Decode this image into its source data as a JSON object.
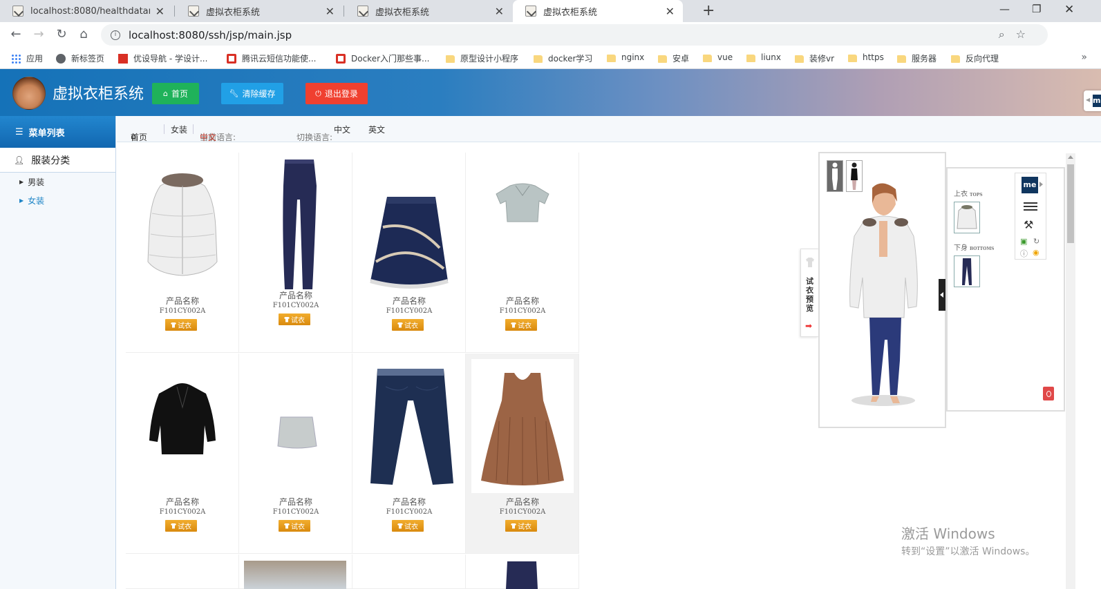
{
  "browser": {
    "tabs": [
      {
        "title": "localhost:8080/healthdataman",
        "active": false
      },
      {
        "title": "虚拟衣柜系统",
        "active": false
      },
      {
        "title": "虚拟衣柜系统",
        "active": false
      },
      {
        "title": "虚拟衣柜系统",
        "active": true
      }
    ],
    "url": "localhost:8080/ssh/jsp/main.jsp",
    "bookmarks": [
      {
        "label": "应用",
        "icon": "apps-grid-icon"
      },
      {
        "label": "新标签页",
        "icon": "globe-icon"
      },
      {
        "label": "优设导航 - 学设计...",
        "icon": "uisdc-icon"
      },
      {
        "label": "腾讯云短信功能使...",
        "icon": "csdn-icon"
      },
      {
        "label": "Docker入门那些事...",
        "icon": "csdn-icon"
      },
      {
        "label": "原型设计小程序",
        "icon": "folder-icon"
      },
      {
        "label": "docker学习",
        "icon": "folder-icon"
      },
      {
        "label": "nginx",
        "icon": "folder-icon"
      },
      {
        "label": "安卓",
        "icon": "folder-icon"
      },
      {
        "label": "vue",
        "icon": "folder-icon"
      },
      {
        "label": "liunx",
        "icon": "folder-icon"
      },
      {
        "label": "装修vr",
        "icon": "folder-icon"
      },
      {
        "label": "https",
        "icon": "folder-icon"
      },
      {
        "label": "服务器",
        "icon": "folder-icon"
      },
      {
        "label": "反向代理",
        "icon": "folder-icon"
      }
    ]
  },
  "header": {
    "title": "虚拟衣柜系统",
    "buttons": [
      {
        "label": "首页",
        "icon": "home-icon",
        "color": "#1fb25a"
      },
      {
        "label": "清除缓存",
        "icon": "wrench-icon",
        "color": "#21a0e6"
      },
      {
        "label": "退出登录",
        "icon": "power-icon",
        "color": "#f0402f"
      }
    ]
  },
  "sidebar": {
    "menu_title": "菜单列表",
    "category_title": "服装分类",
    "items": [
      {
        "label": "男装",
        "active": false
      },
      {
        "label": "女装",
        "active": true
      }
    ]
  },
  "breadcrumb": {
    "home": "首页",
    "current": "女装",
    "current_lang_label": "当前语言:",
    "current_lang_value": "中文",
    "switch_lang_label": "切换语言:",
    "switch_options": [
      "中文",
      "英文"
    ]
  },
  "products": [
    {
      "name": "产品名称",
      "code": "F101CY002A",
      "button": "试衣",
      "image": "white-down-jacket"
    },
    {
      "name": "产品名称",
      "code": "F101CY002A",
      "button": "试衣",
      "image": "navy-leggings"
    },
    {
      "name": "产品名称",
      "code": "F101CY002A",
      "button": "试衣",
      "image": "navy-lace-skirt"
    },
    {
      "name": "产品名称",
      "code": "F101CY002A",
      "button": "试衣",
      "image": "grey-short-sleeve-blouse"
    },
    {
      "name": "产品名称",
      "code": "F101CY002A",
      "button": "试衣",
      "image": "black-coat"
    },
    {
      "name": "产品名称",
      "code": "F101CY002A",
      "button": "试衣",
      "image": "grey-mini-skirt"
    },
    {
      "name": "产品名称",
      "code": "F101CY002A",
      "button": "试衣",
      "image": "dark-blue-jeans"
    },
    {
      "name": "产品名称",
      "code": "F101CY002A",
      "button": "试衣",
      "image": "brown-pleated-top"
    }
  ],
  "tryon": {
    "side_tab_label": "试衣预览",
    "tops_label": "上衣",
    "tops_en": "TOPS",
    "bottoms_label": "下身",
    "bottoms_en": "BOTTOMS",
    "brand": "me"
  },
  "watermark": {
    "line1": "激活 Windows",
    "line2": "转到“设置”以激活 Windows。"
  }
}
